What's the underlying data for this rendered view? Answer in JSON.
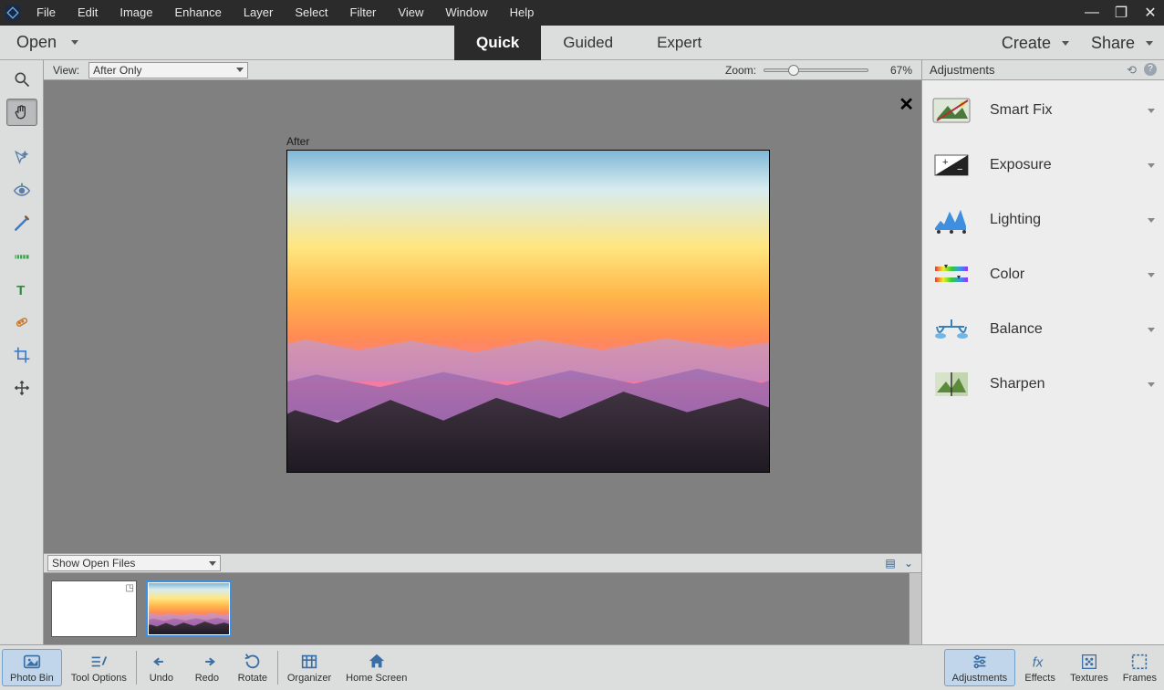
{
  "menubar": [
    "File",
    "Edit",
    "Image",
    "Enhance",
    "Layer",
    "Select",
    "Filter",
    "View",
    "Window",
    "Help"
  ],
  "modebar": {
    "open": "Open",
    "tabs": [
      "Quick",
      "Guided",
      "Expert"
    ],
    "active_tab": "Quick",
    "create": "Create",
    "share": "Share"
  },
  "viewbar": {
    "label": "View:",
    "option": "After Only",
    "zoom_label": "Zoom:",
    "zoom_value": "67%"
  },
  "canvas": {
    "label": "After"
  },
  "openfiles": {
    "option": "Show Open Files"
  },
  "adjustments": {
    "title": "Adjustments",
    "items": [
      "Smart Fix",
      "Exposure",
      "Lighting",
      "Color",
      "Balance",
      "Sharpen"
    ]
  },
  "bottombar": {
    "left": [
      "Photo Bin",
      "Tool Options",
      "Undo",
      "Redo",
      "Rotate",
      "Organizer",
      "Home Screen"
    ],
    "right": [
      "Adjustments",
      "Effects",
      "Textures",
      "Frames"
    ]
  },
  "tools": [
    "zoom",
    "hand",
    "magic-wand",
    "red-eye",
    "brush",
    "straighten",
    "text",
    "spot-heal",
    "crop",
    "move"
  ]
}
